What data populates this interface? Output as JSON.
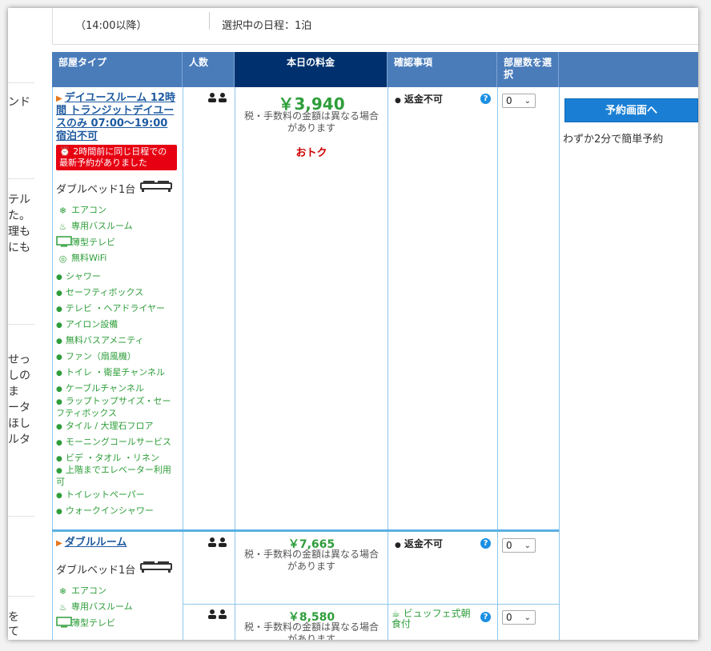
{
  "left_fragments": [
    "ンド",
    "テル",
    "た。",
    "理も",
    "にも",
    "せっ",
    "しの",
    "ま",
    "ータ",
    "ほし",
    "ルタ",
    "を",
    "て"
  ],
  "top": {
    "checkin": "（14:00以降）",
    "schedule": "選択中の日程：1泊"
  },
  "headers": {
    "room_type": "部屋タイプ",
    "people": "人数",
    "price_today": "本日の料金",
    "confirm": "確認事項",
    "select_rooms": "部屋数を選択"
  },
  "room1": {
    "name": "デイユースルーム 12時間 トランジットデイユースのみ 07:00〜19:00 宿泊不可",
    "alert": "2時間前に同じ日程での最新予約がありました",
    "bed": "ダブルベッド1台",
    "amenities_icon": [
      {
        "icon": "snowflake-icon",
        "label": "エアコン"
      },
      {
        "icon": "shower-icon",
        "label": "専用バスルーム"
      },
      {
        "icon": "tv-icon",
        "label": "薄型テレビ"
      },
      {
        "icon": "wifi-icon",
        "label": "無料WiFi"
      }
    ],
    "amenities_bullet": [
      "シャワー",
      "セーフティボックス",
      "テレビ ・ヘアドライヤー",
      "アイロン設備",
      "無料バスアメニティ",
      "ファン（扇風機）",
      "トイレ ・衛星チャンネル",
      "ケーブルチャンネル",
      "ラップトップサイズ・セーフティボックス",
      "タイル / 大理石フロア",
      "モーニングコールサービス",
      "ビデ ・タオル ・リネン",
      "上階までエレベーター利用可",
      "トイレットペーパー",
      "ウォークインシャワー"
    ],
    "price": "￥3,940",
    "price_note": "税・手数料の金額は異なる場合があります",
    "deal": "おトク",
    "confirm": "返金不可",
    "select_value": "0"
  },
  "booking": {
    "button": "予約画面へ",
    "note": "わずか2分で簡単予約"
  },
  "room2": {
    "name": "ダブルルーム",
    "bed": "ダブルベッド1台",
    "amenities_icon": [
      {
        "icon": "snowflake-icon",
        "label": "エアコン"
      },
      {
        "icon": "shower-icon",
        "label": "専用バスルーム"
      },
      {
        "icon": "tv-icon",
        "label": "薄型テレビ"
      }
    ],
    "offers": [
      {
        "price": "￥7,665",
        "price_note": "税・手数料の金額は異なる場合があります",
        "confirm": "返金不可",
        "select_value": "0"
      },
      {
        "price": "￥8,580",
        "price_note": "税・手数料の金額は異なる場合があります",
        "confirm": "ビュッフェ式朝食付",
        "select_value": "0"
      }
    ]
  },
  "colors": {
    "header_blue": "#4a7cba",
    "header_dark": "#00316e",
    "price_green": "#2e9e3a",
    "link_blue": "#1e5aa0",
    "alert_red": "#e60012",
    "button_blue": "#1a7fd4"
  }
}
